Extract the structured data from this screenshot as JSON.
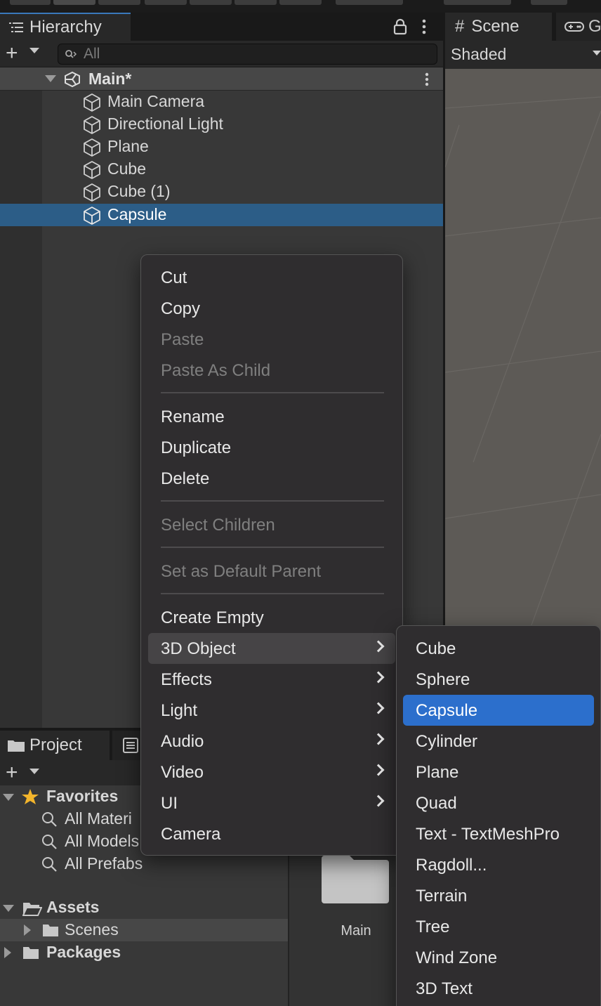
{
  "hierarchy": {
    "tab_label": "Hierarchy",
    "search_placeholder": "All",
    "scene_name": "Main*",
    "items": [
      {
        "label": "Main Camera"
      },
      {
        "label": "Directional Light"
      },
      {
        "label": "Plane"
      },
      {
        "label": "Cube"
      },
      {
        "label": "Cube (1)"
      },
      {
        "label": "Capsule",
        "selected": true
      }
    ]
  },
  "scene": {
    "tab_label": "Scene",
    "game_tab_label": "G",
    "shading_mode": "Shaded"
  },
  "project": {
    "tab_label": "Project",
    "favorites_label": "Favorites",
    "favorites": [
      {
        "label": "All Materi"
      },
      {
        "label": "All Models"
      },
      {
        "label": "All Prefabs"
      }
    ],
    "assets_label": "Assets",
    "scenes_label": "Scenes",
    "packages_label": "Packages",
    "asset_items": [
      {
        "label": "Main"
      }
    ]
  },
  "context_menu": {
    "items": [
      {
        "label": "Cut",
        "enabled": true
      },
      {
        "label": "Copy",
        "enabled": true
      },
      {
        "label": "Paste",
        "enabled": false
      },
      {
        "label": "Paste As Child",
        "enabled": false
      },
      {
        "label": "Rename",
        "enabled": true
      },
      {
        "label": "Duplicate",
        "enabled": true
      },
      {
        "label": "Delete",
        "enabled": true
      },
      {
        "label": "Select Children",
        "enabled": false
      },
      {
        "label": "Set as Default Parent",
        "enabled": false
      },
      {
        "label": "Create Empty",
        "enabled": true
      },
      {
        "label": "3D Object",
        "enabled": true,
        "submenu": true,
        "highlighted": true
      },
      {
        "label": "Effects",
        "enabled": true,
        "submenu": true
      },
      {
        "label": "Light",
        "enabled": true,
        "submenu": true
      },
      {
        "label": "Audio",
        "enabled": true,
        "submenu": true
      },
      {
        "label": "Video",
        "enabled": true,
        "submenu": true
      },
      {
        "label": "UI",
        "enabled": true,
        "submenu": true
      },
      {
        "label": "Camera",
        "enabled": true
      }
    ]
  },
  "submenu_3d_object": {
    "items": [
      {
        "label": "Cube"
      },
      {
        "label": "Sphere"
      },
      {
        "label": "Capsule",
        "active": true
      },
      {
        "label": "Cylinder"
      },
      {
        "label": "Plane"
      },
      {
        "label": "Quad"
      },
      {
        "label": "Text - TextMeshPro"
      },
      {
        "label": "Ragdoll..."
      },
      {
        "label": "Terrain"
      },
      {
        "label": "Tree"
      },
      {
        "label": "Wind Zone"
      },
      {
        "label": "3D Text"
      }
    ]
  },
  "colors": {
    "selection": "#2c5d87",
    "menu_active": "#2c6fcc",
    "panel_bg": "#383838",
    "menu_bg": "#2f2d2f",
    "tab_accent": "#3a79bb"
  }
}
